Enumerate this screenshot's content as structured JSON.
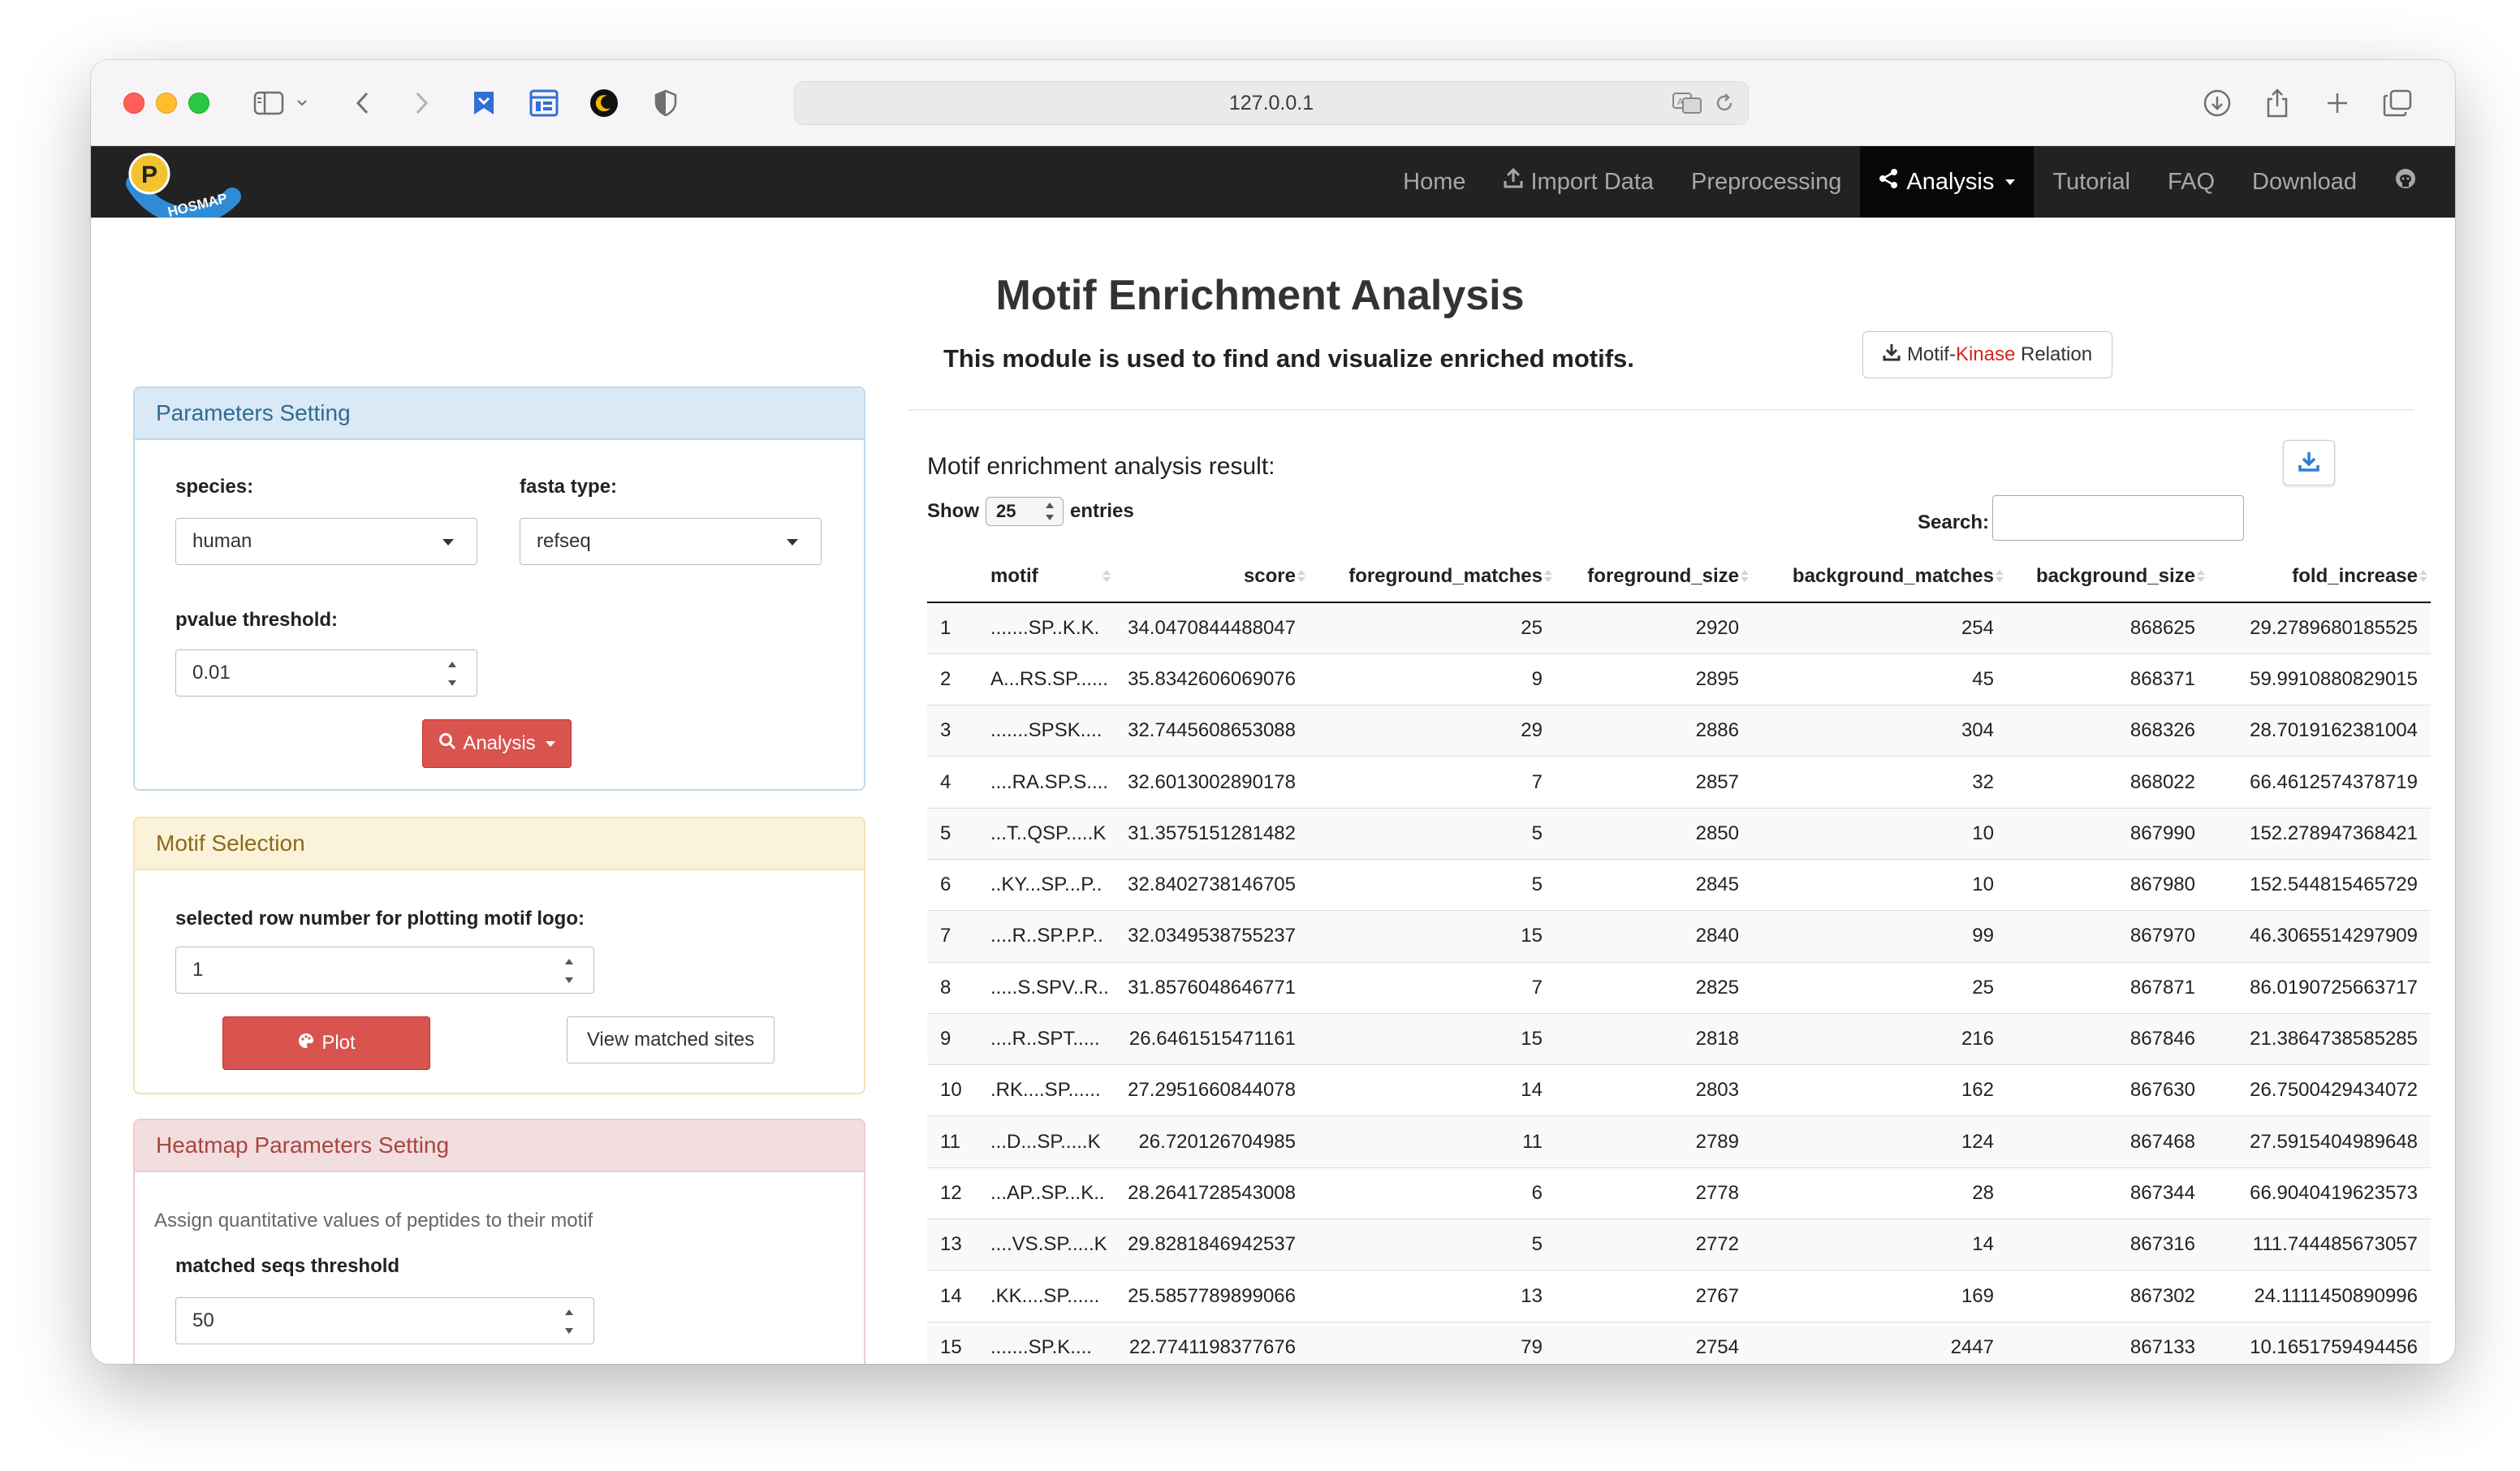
{
  "browser": {
    "url": "127.0.0.1"
  },
  "navbar": {
    "logo_text": "PHOSMAP",
    "items": [
      {
        "label": "Home"
      },
      {
        "label": "Import Data"
      },
      {
        "label": "Preprocessing"
      },
      {
        "label": "Analysis"
      },
      {
        "label": "Tutorial"
      },
      {
        "label": "FAQ"
      },
      {
        "label": "Download"
      }
    ]
  },
  "header": {
    "title": "Motif Enrichment Analysis",
    "description": "This module is used to find and visualize enriched motifs.",
    "relation_button_prefix": "Motif-",
    "relation_button_kinase": "Kinase",
    "relation_button_suffix": " Relation"
  },
  "params_panel": {
    "title": "Parameters Setting",
    "species_label": "species:",
    "species_value": "human",
    "fasta_label": "fasta type:",
    "fasta_value": "refseq",
    "pvalue_label": "pvalue threshold:",
    "pvalue_value": "0.01",
    "analysis_button": "Analysis"
  },
  "motif_panel": {
    "title": "Motif Selection",
    "row_label": "selected row number for plotting motif logo:",
    "row_value": "1",
    "plot_button": "Plot",
    "view_button": "View matched sites"
  },
  "heatmap_panel": {
    "title": "Heatmap Parameters Setting",
    "description": "Assign quantitative values of peptides to their motif",
    "threshold_label": "matched seqs threshold",
    "threshold_value": "50"
  },
  "results": {
    "title": "Motif enrichment analysis result:",
    "show_label": "Show",
    "entries_value": "25",
    "entries_label": "entries",
    "search_label": "Search:",
    "columns": [
      "",
      "motif",
      "score",
      "foreground_matches",
      "foreground_size",
      "background_matches",
      "background_size",
      "fold_increase"
    ],
    "rows": [
      [
        "1",
        ".......SP..K.K.",
        "34.0470844488047",
        "25",
        "2920",
        "254",
        "868625",
        "29.2789680185525"
      ],
      [
        "2",
        "A...RS.SP......",
        "35.8342606069076",
        "9",
        "2895",
        "45",
        "868371",
        "59.9910880829015"
      ],
      [
        "3",
        ".......SPSK....",
        "32.7445608653088",
        "29",
        "2886",
        "304",
        "868326",
        "28.7019162381004"
      ],
      [
        "4",
        "....RA.SP.S....",
        "32.6013002890178",
        "7",
        "2857",
        "32",
        "868022",
        "66.4612574378719"
      ],
      [
        "5",
        "...T..QSP.....K",
        "31.3575151281482",
        "5",
        "2850",
        "10",
        "867990",
        "152.278947368421"
      ],
      [
        "6",
        "..KY...SP...P..",
        "32.8402738146705",
        "5",
        "2845",
        "10",
        "867980",
        "152.544815465729"
      ],
      [
        "7",
        "....R..SP.P.P..",
        "32.0349538755237",
        "15",
        "2840",
        "99",
        "867970",
        "46.3065514297909"
      ],
      [
        "8",
        ".....S.SPV..R..",
        "31.8576048646771",
        "7",
        "2825",
        "25",
        "867871",
        "86.0190725663717"
      ],
      [
        "9",
        "....R..SPT.....",
        "26.6461515471161",
        "15",
        "2818",
        "216",
        "867846",
        "21.3864738585285"
      ],
      [
        "10",
        ".RK....SP......",
        "27.2951660844078",
        "14",
        "2803",
        "162",
        "867630",
        "26.7500429434072"
      ],
      [
        "11",
        "...D...SP.....K",
        "26.720126704985",
        "11",
        "2789",
        "124",
        "867468",
        "27.5915404989648"
      ],
      [
        "12",
        "...AP..SP...K..",
        "28.2641728543008",
        "6",
        "2778",
        "28",
        "867344",
        "66.9040419623573"
      ],
      [
        "13",
        "....VS.SP.....K",
        "29.8281846942537",
        "5",
        "2772",
        "14",
        "867316",
        "111.744485673057"
      ],
      [
        "14",
        ".KK....SP......",
        "25.5857789899066",
        "13",
        "2767",
        "169",
        "867302",
        "24.1111450890996"
      ],
      [
        "15",
        ".......SP.K....",
        "22.7741198377676",
        "79",
        "2754",
        "2447",
        "867133",
        "10.1651759494456"
      ]
    ]
  },
  "colors": {
    "navbar_bg": "#222222",
    "navbar_active": "#080808",
    "danger": "#d9534f",
    "primary_head": "#d9e9f5",
    "warning_head": "#fbf3d9",
    "error_head": "#f2dede",
    "kinase_red": "#d9251d"
  }
}
